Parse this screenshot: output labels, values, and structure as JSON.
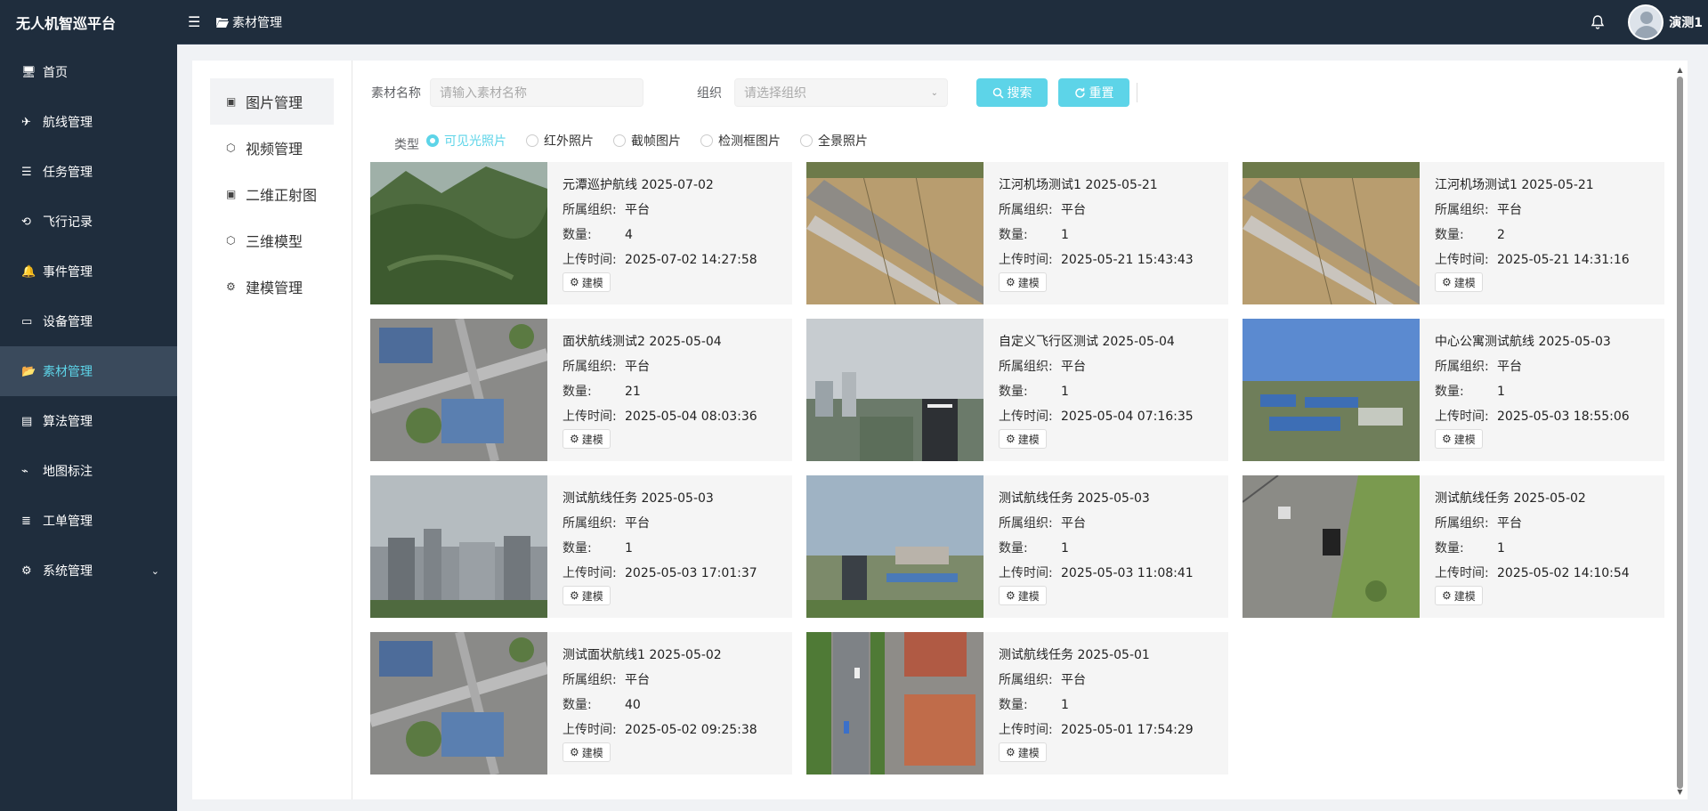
{
  "app": {
    "title": "无人机智巡平台"
  },
  "sidebar": {
    "items": [
      {
        "label": "首页",
        "icon": "monitor-icon"
      },
      {
        "label": "航线管理",
        "icon": "plane-icon"
      },
      {
        "label": "任务管理",
        "icon": "list-icon"
      },
      {
        "label": "飞行记录",
        "icon": "history-icon"
      },
      {
        "label": "事件管理",
        "icon": "bell-icon"
      },
      {
        "label": "设备管理",
        "icon": "device-icon"
      },
      {
        "label": "素材管理",
        "icon": "folder-open-icon",
        "active": true
      },
      {
        "label": "算法管理",
        "icon": "algorithm-icon"
      },
      {
        "label": "地图标注",
        "icon": "map-mark-icon"
      },
      {
        "label": "工单管理",
        "icon": "workorder-icon"
      },
      {
        "label": "系统管理",
        "icon": "gear-icon",
        "has_children": true
      }
    ]
  },
  "header": {
    "breadcrumb": "素材管理",
    "username": "演测1"
  },
  "submenu": {
    "items": [
      {
        "label": "图片管理",
        "active": true
      },
      {
        "label": "视频管理"
      },
      {
        "label": "二维正射图"
      },
      {
        "label": "三维模型"
      },
      {
        "label": "建模管理"
      }
    ]
  },
  "filters": {
    "name_label": "素材名称",
    "name_placeholder": "请输入素材名称",
    "org_label": "组织",
    "org_placeholder": "请选择组织",
    "search_label": "搜索",
    "reset_label": "重置",
    "type_label": "类型",
    "types": [
      "可见光照片",
      "红外照片",
      "截帧图片",
      "检测框图片",
      "全景照片"
    ],
    "selected_type": "可见光照片"
  },
  "card_labels": {
    "org": "所属组织:",
    "count": "数量:",
    "time": "上传时间:",
    "model_button": "建模"
  },
  "cards": [
    {
      "title": "元潭巡护航线 2025-07-02",
      "org": "平台",
      "count": "4",
      "time": "2025-07-02 14:27:58",
      "thumb": "mountain"
    },
    {
      "title": "江河机场测试1 2025-05-21",
      "org": "平台",
      "count": "1",
      "time": "2025-05-21 15:43:43",
      "thumb": "field"
    },
    {
      "title": "江河机场测试1 2025-05-21",
      "org": "平台",
      "count": "2",
      "time": "2025-05-21 14:31:16",
      "thumb": "field"
    },
    {
      "title": "面状航线测试2 2025-05-04",
      "org": "平台",
      "count": "21",
      "time": "2025-05-04 08:03:36",
      "thumb": "aerial"
    },
    {
      "title": "自定义飞行区测试 2025-05-04",
      "org": "平台",
      "count": "1",
      "time": "2025-05-04 07:16:35",
      "thumb": "city"
    },
    {
      "title": "中心公寓测试航线 2025-05-03",
      "org": "平台",
      "count": "1",
      "time": "2025-05-03 18:55:06",
      "thumb": "industrial"
    },
    {
      "title": "测试航线任务 2025-05-03",
      "org": "平台",
      "count": "1",
      "time": "2025-05-03 17:01:37",
      "thumb": "city2"
    },
    {
      "title": "测试航线任务 2025-05-03",
      "org": "平台",
      "count": "1",
      "time": "2025-05-03 11:08:41",
      "thumb": "city3"
    },
    {
      "title": "测试航线任务 2025-05-02",
      "org": "平台",
      "count": "1",
      "time": "2025-05-02 14:10:54",
      "thumb": "ground"
    },
    {
      "title": "测试面状航线1 2025-05-02",
      "org": "平台",
      "count": "40",
      "time": "2025-05-02 09:25:38",
      "thumb": "aerial"
    },
    {
      "title": "测试航线任务 2025-05-01",
      "org": "平台",
      "count": "1",
      "time": "2025-05-01 17:54:29",
      "thumb": "street"
    }
  ],
  "colors": {
    "accent": "#5dd4e8",
    "sidebar_bg": "#1f2d3d",
    "active_bg": "#3a4a5c"
  }
}
